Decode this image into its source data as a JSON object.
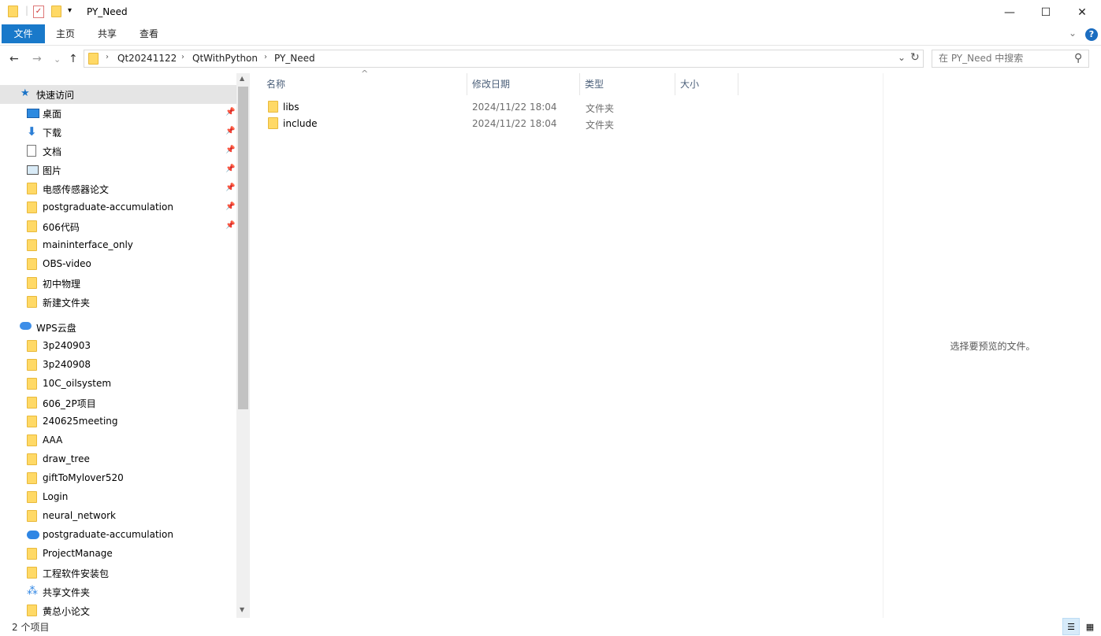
{
  "window": {
    "title": "PY_Need",
    "minimize": "—",
    "maximize": "☐",
    "close": "✕"
  },
  "ribbon": {
    "tabs": [
      "文件",
      "主页",
      "共享",
      "查看"
    ],
    "expand": "⌄",
    "help": "?"
  },
  "nav": {
    "back": "←",
    "forward": "→",
    "recent": "⌄",
    "up": "↑"
  },
  "address": {
    "crumbs": [
      "Qt20241122",
      "QtWithPython",
      "PY_Need"
    ],
    "sep": "›",
    "dropdown": "⌄",
    "refresh": "↻"
  },
  "search": {
    "placeholder": "在 PY_Need 中搜索",
    "icon": "⚲"
  },
  "sidebar": {
    "quick_access": "快速访问",
    "pin": "📌",
    "items": [
      {
        "label": "桌面",
        "icon": "desktop-icon"
      },
      {
        "label": "下载",
        "icon": "download-icon"
      },
      {
        "label": "文档",
        "icon": "document-icon"
      },
      {
        "label": "图片",
        "icon": "pictures-icon"
      },
      {
        "label": "电感传感器论文",
        "icon": "folder-icon"
      },
      {
        "label": "postgraduate-accumulation",
        "icon": "folder-icon"
      },
      {
        "label": "606代码",
        "icon": "folder-icon"
      },
      {
        "label": "maininterface_only",
        "icon": "folder-icon"
      },
      {
        "label": "OBS-video",
        "icon": "folder-icon"
      },
      {
        "label": "初中物理",
        "icon": "folder-icon"
      },
      {
        "label": "新建文件夹",
        "icon": "folder-icon"
      }
    ],
    "wps": "WPS云盘",
    "wps_items": [
      {
        "label": "3p240903",
        "icon": "folder-icon"
      },
      {
        "label": "3p240908",
        "icon": "folder-icon"
      },
      {
        "label": "10C_oilsystem",
        "icon": "folder-icon"
      },
      {
        "label": "606_2P项目",
        "icon": "folder-icon"
      },
      {
        "label": "240625meeting",
        "icon": "folder-icon"
      },
      {
        "label": "AAA",
        "icon": "folder-icon"
      },
      {
        "label": "draw_tree",
        "icon": "folder-icon"
      },
      {
        "label": "giftToMylover520",
        "icon": "folder-icon"
      },
      {
        "label": "Login",
        "icon": "folder-icon"
      },
      {
        "label": "neural_network",
        "icon": "folder-icon"
      },
      {
        "label": "postgraduate-accumulation",
        "icon": "cloud-icon"
      },
      {
        "label": "ProjectManage",
        "icon": "folder-icon"
      },
      {
        "label": "工程软件安装包",
        "icon": "folder-icon"
      },
      {
        "label": "共享文件夹",
        "icon": "share-icon"
      },
      {
        "label": "黄总小论文",
        "icon": "folder-icon"
      }
    ]
  },
  "columns": {
    "name": "名称",
    "date": "修改日期",
    "type": "类型",
    "size": "大小",
    "sort": "^"
  },
  "files": [
    {
      "name": "libs",
      "date": "2024/11/22 18:04",
      "type": "文件夹"
    },
    {
      "name": "include",
      "date": "2024/11/22 18:04",
      "type": "文件夹"
    }
  ],
  "preview": {
    "message": "选择要预览的文件。"
  },
  "status": {
    "count": "2 个项目"
  }
}
